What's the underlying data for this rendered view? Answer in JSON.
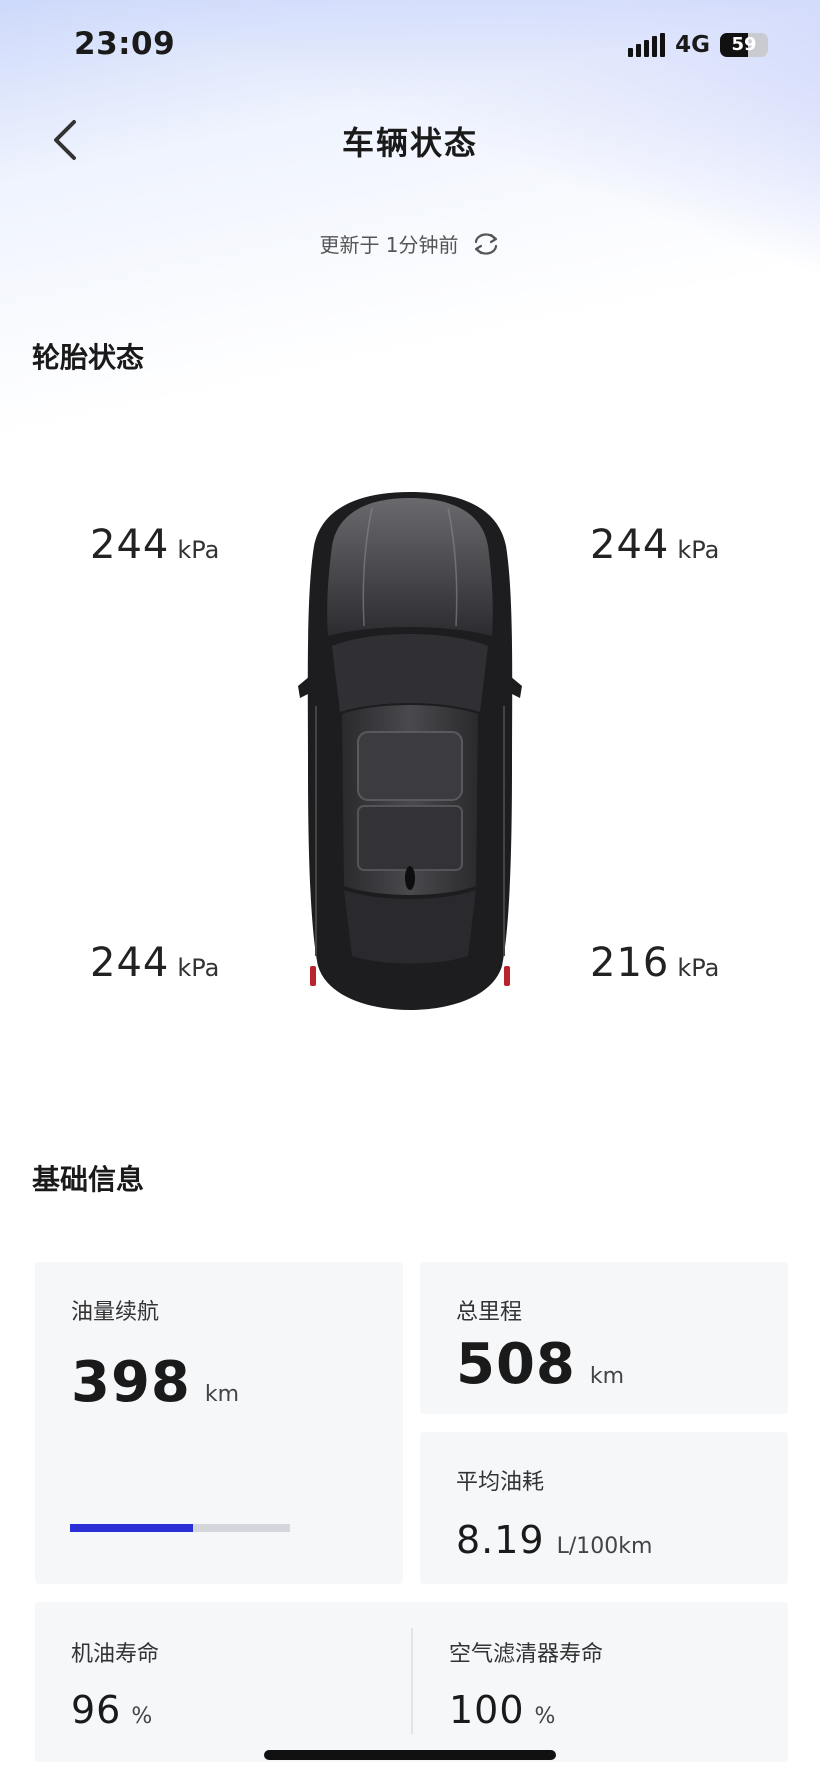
{
  "status_bar": {
    "time": "23:09",
    "network": "4G",
    "battery": "59",
    "battery_level": 0.59
  },
  "header": {
    "title": "车辆状态",
    "update_text": "更新于 1分钟前"
  },
  "tires": {
    "section_title": "轮胎状态",
    "unit": "kPa",
    "front_left": "244",
    "front_right": "244",
    "rear_left": "244",
    "rear_right": "216"
  },
  "basic_info": {
    "section_title": "基础信息",
    "fuel_range": {
      "label": "油量续航",
      "value": "398",
      "unit": "km",
      "fuel_level": 0.56
    },
    "odometer": {
      "label": "总里程",
      "value": "508",
      "unit": "km"
    },
    "avg_consumption": {
      "label": "平均油耗",
      "value": "8.19",
      "unit": "L/100km"
    },
    "oil_life": {
      "label": "机油寿命",
      "value": "96",
      "unit": "%"
    },
    "air_filter_life": {
      "label": "空气滤清器寿命",
      "value": "100",
      "unit": "%"
    }
  },
  "colors": {
    "accent": "#2b2fd6",
    "track": "#d4d6db",
    "card_bg": "#f6f7f9",
    "car_body": "#1f1f21"
  }
}
